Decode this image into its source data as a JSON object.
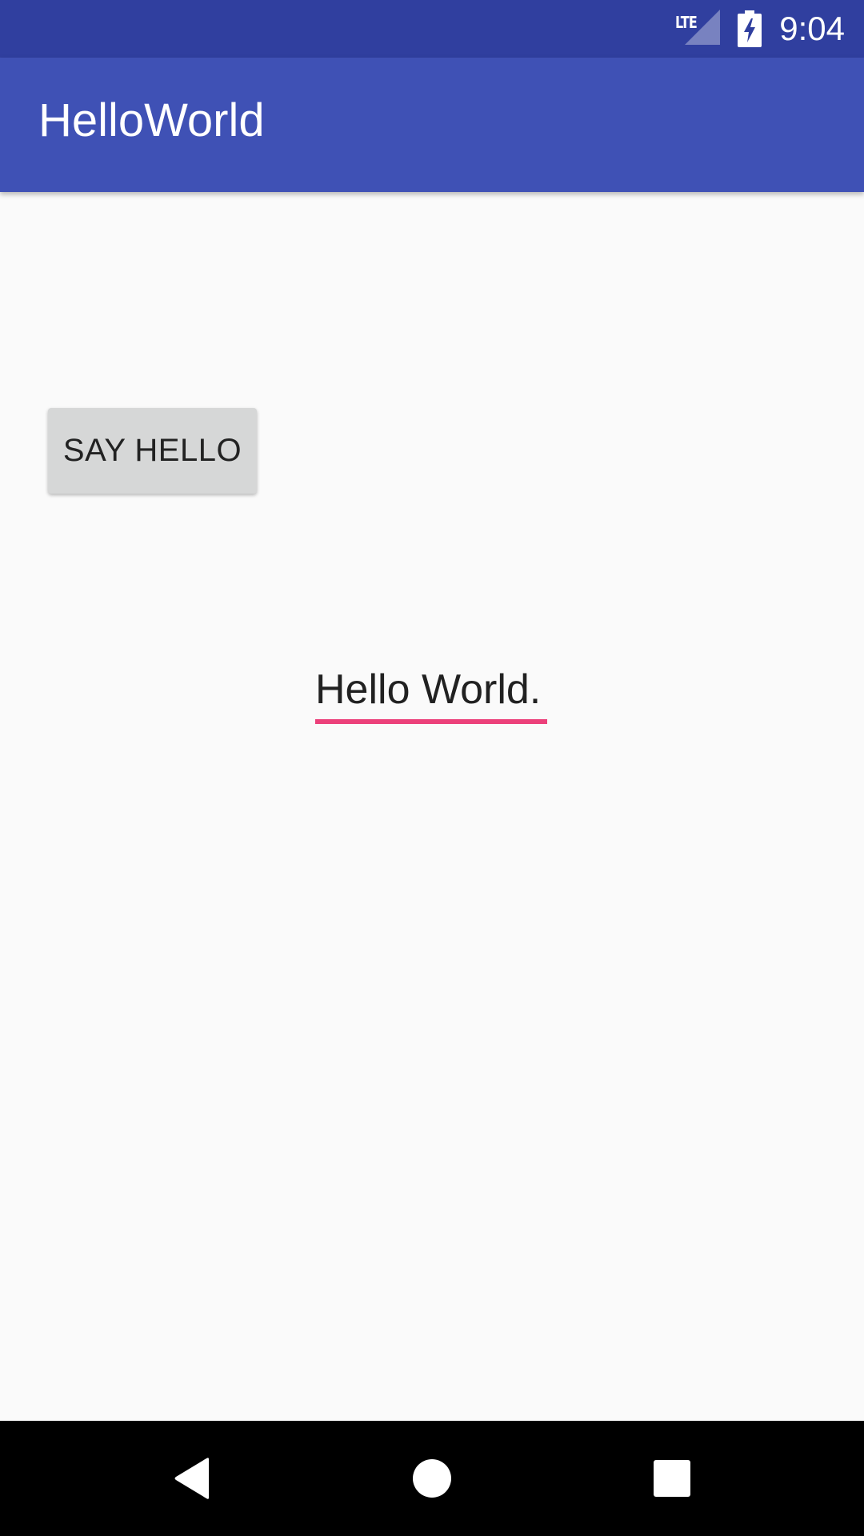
{
  "status_bar": {
    "network_label": "LTE",
    "time": "9:04",
    "icons": [
      "lte-signal-icon",
      "battery-charging-icon"
    ],
    "color": "#303F9F"
  },
  "app_bar": {
    "title": "HelloWorld",
    "color": "#3F51B5"
  },
  "main": {
    "say_hello_button_label": "SAY HELLO",
    "hello_field_value": "Hello World.",
    "accent_color": "#EC407A"
  },
  "nav_bar": {
    "icons": [
      "back-icon",
      "home-icon",
      "recents-icon"
    ]
  }
}
